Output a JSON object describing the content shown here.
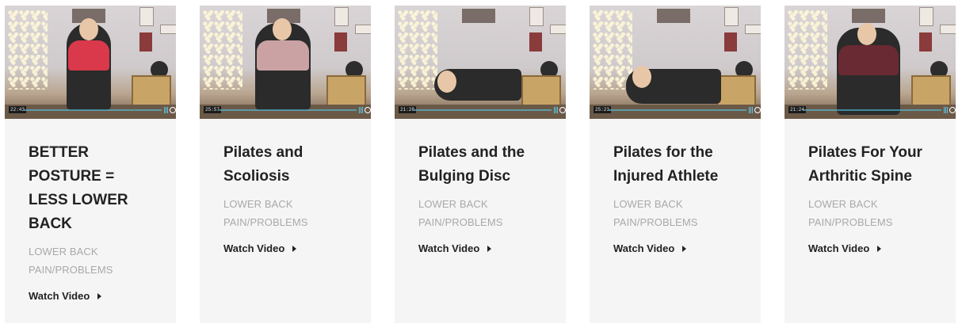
{
  "cards": [
    {
      "title": "BETTER POSTURE = LESS LOWER BACK",
      "category": "LOWER BACK PAIN/PROBLEMS",
      "watch_label": "Watch Video",
      "duration": "22:43",
      "top_color": "#d9394a",
      "bottom_color": "#1f1f1f"
    },
    {
      "title": "Pilates and Scoliosis",
      "category": "LOWER BACK PAIN/PROBLEMS",
      "watch_label": "Watch Video",
      "duration": "25:57",
      "top_color": "#caa2a4",
      "bottom_color": "#1f1f1f"
    },
    {
      "title": "Pilates and the Bulging Disc",
      "category": "LOWER BACK PAIN/PROBLEMS",
      "watch_label": "Watch Video",
      "duration": "21:28",
      "top_color": "#2b2b2b",
      "bottom_color": "#1f1f1f"
    },
    {
      "title": "Pilates for the Injured Athlete",
      "category": "LOWER BACK PAIN/PROBLEMS",
      "watch_label": "Watch Video",
      "duration": "25:23",
      "top_color": "#2b2b2b",
      "bottom_color": "#1f1f1f"
    },
    {
      "title": "Pilates For Your Arthritic Spine",
      "category": "LOWER BACK PAIN/PROBLEMS",
      "watch_label": "Watch Video",
      "duration": "21:24",
      "top_color": "#6a2a33",
      "bottom_color": "#1f1f1f"
    }
  ],
  "colors": {
    "card_background": "#f5f5f5",
    "title_text": "#222222",
    "category_text": "#a9a9a9",
    "player_accent": "#5ec7e6"
  }
}
